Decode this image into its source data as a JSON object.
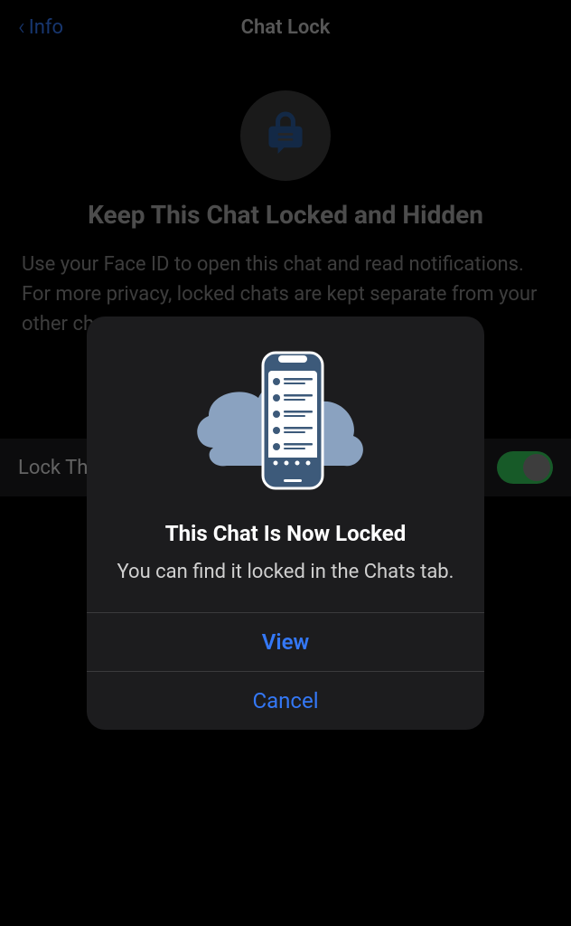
{
  "nav": {
    "back_label": "Info",
    "title": "Chat Lock"
  },
  "hero": {
    "title": "Keep This Chat Locked and Hidden",
    "description": "Use your Face ID to open this chat and read notifications. For more privacy, locked chats are kept separate from your other chats."
  },
  "toggle": {
    "label": "Lock This Chat",
    "enabled": true
  },
  "modal": {
    "title": "This Chat Is Now Locked",
    "message": "You can find it locked in the Chats tab.",
    "primary_action": "View",
    "secondary_action": "Cancel"
  }
}
